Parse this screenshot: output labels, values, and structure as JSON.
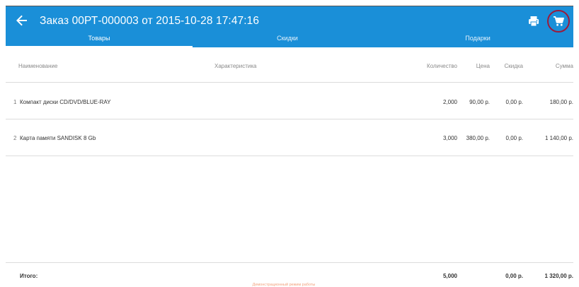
{
  "header": {
    "title": "Заказ 00РТ-000003 от 2015-10-28 17:47:16"
  },
  "tabs": [
    {
      "label": "Товары"
    },
    {
      "label": "Скидки"
    },
    {
      "label": "Подарки"
    }
  ],
  "table": {
    "columns": {
      "name": "Наименование",
      "characteristic": "Характеристика",
      "quantity": "Количество",
      "price": "Цена",
      "discount": "Скидка",
      "sum": "Сумма"
    },
    "rows": [
      {
        "num": "1",
        "name": "Компакт диски CD/DVD/BLUE-RAY",
        "characteristic": "",
        "quantity": "2,000",
        "price": "90,00 р.",
        "discount": "0,00 р.",
        "sum": "180,00 р."
      },
      {
        "num": "2",
        "name": "Карта памяти SANDISK 8 Gb",
        "characteristic": "",
        "quantity": "3,000",
        "price": "380,00 р.",
        "discount": "0,00 р.",
        "sum": "1 140,00 р."
      }
    ],
    "totals": {
      "label": "Итого:",
      "quantity": "5,000",
      "discount": "0,00 р.",
      "sum": "1 320,00 р."
    }
  },
  "footer": {
    "note": "Демонстрационный режим работы"
  },
  "icons": {
    "back": "arrow-left-icon",
    "print": "printer-icon",
    "cart": "cart-icon"
  },
  "colors": {
    "primary": "#1a8fd8",
    "highlight_ring": "#9a1b3c",
    "note": "#f2a07b"
  }
}
